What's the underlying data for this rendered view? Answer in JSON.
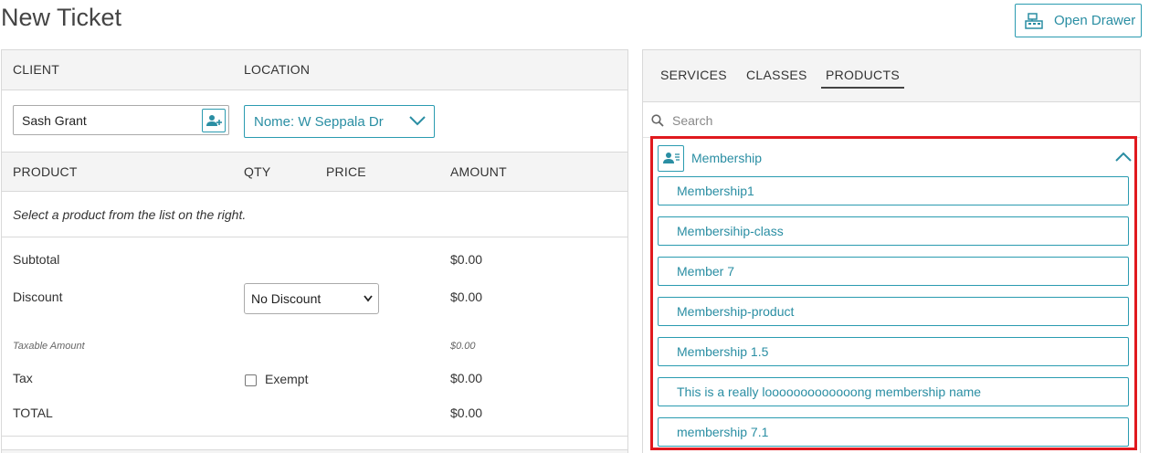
{
  "page": {
    "title": "New Ticket"
  },
  "toolbar": {
    "open_drawer_label": "Open Drawer"
  },
  "ticket": {
    "headers": {
      "client": "CLIENT",
      "location": "LOCATION"
    },
    "client_value": "Sash Grant",
    "location_value": "Nome: W Seppala Dr",
    "line_headers": {
      "product": "PRODUCT",
      "qty": "QTY",
      "price": "PRICE",
      "amount": "AMOUNT"
    },
    "hint": "Select a product from the list on the right.",
    "totals": {
      "subtotal_label": "Subtotal",
      "subtotal_value": "$0.00",
      "discount_label": "Discount",
      "discount_selected": "No Discount",
      "discount_value": "$0.00",
      "taxable_label": "Taxable Amount",
      "taxable_value": "$0.00",
      "tax_label": "Tax",
      "exempt_label": "Exempt",
      "tax_value": "$0.00",
      "total_label": "TOTAL",
      "total_value": "$0.00"
    }
  },
  "catalog": {
    "tabs": [
      "SERVICES",
      "CLASSES",
      "PRODUCTS"
    ],
    "active_tab": "PRODUCTS",
    "search_placeholder": "Search",
    "section": {
      "label": "Membership",
      "items": [
        "Membership1",
        "Membersihip-class",
        "Member 7",
        "Membership-product",
        "Membership 1.5",
        "This is a really looooooooooooong membership name",
        "membership 7.1"
      ]
    }
  },
  "colors": {
    "accent": "#2a8ea3",
    "highlight": "#e0191e",
    "header_bg": "#f4f4f4"
  }
}
